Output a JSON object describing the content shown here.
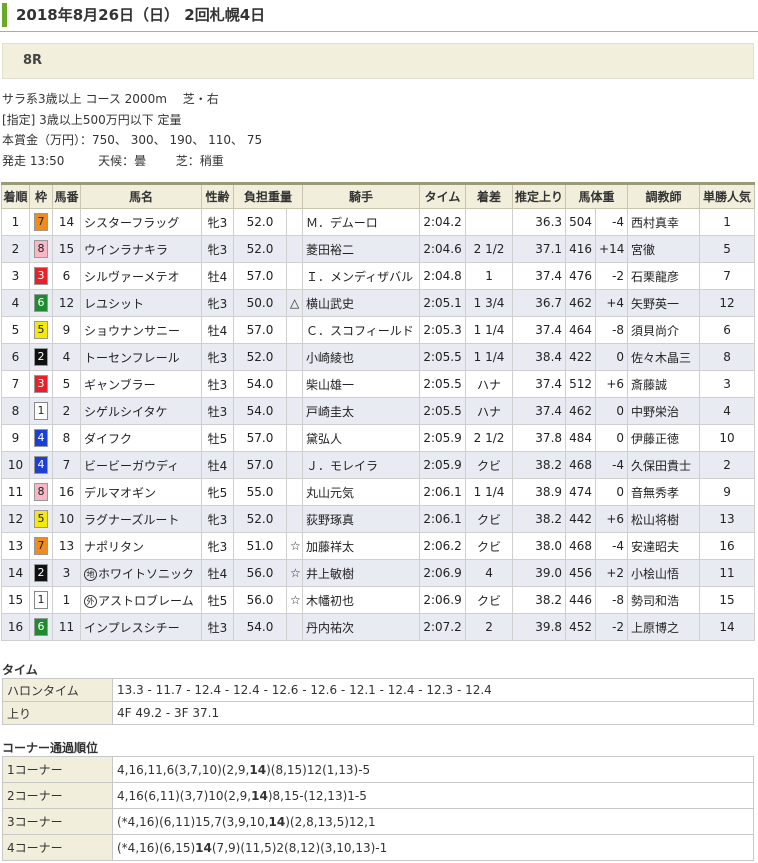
{
  "header": {
    "title": "2018年8月26日（日） 2回札幌4日",
    "race_number": "8R"
  },
  "race_info": {
    "line1": "サラ系3歳以上 コース 2000m　 芝・右",
    "line2": "[指定] 3歳以上500万円以下 定量",
    "line3": "本賞金（万円）：750、 300、 190、 110、 75",
    "line4_start": "発走 13:50",
    "line4_weather": "天候：曇",
    "line4_going": "芝：稍重"
  },
  "table": {
    "headers": [
      "着順",
      "枠",
      "馬番",
      "馬名",
      "性齢",
      "負担重量",
      "",
      "騎手",
      "タイム",
      "着差",
      "推定上り",
      "馬体重",
      "",
      "調教師",
      "単勝人気"
    ],
    "rows": [
      {
        "rank": "1",
        "waku": "7",
        "num": "14",
        "mark": "",
        "name": "シスターフラッグ",
        "sexage": "牝3",
        "weight": "52.0",
        "jmark": "",
        "jockey": "Ｍ．デムーロ",
        "time": "2:04.2",
        "margin": "",
        "agari": "36.3",
        "bw": "504",
        "bwdiff": "-4",
        "trainer": "西村真幸",
        "pop": "1"
      },
      {
        "rank": "2",
        "waku": "8",
        "num": "15",
        "mark": "",
        "name": "ウインラナキラ",
        "sexage": "牝3",
        "weight": "52.0",
        "jmark": "",
        "jockey": "菱田裕二",
        "time": "2:04.6",
        "margin": "2 1/2",
        "agari": "37.1",
        "bw": "416",
        "bwdiff": "+14",
        "trainer": "宮徹",
        "pop": "5"
      },
      {
        "rank": "3",
        "waku": "3",
        "num": "6",
        "mark": "",
        "name": "シルヴァーメテオ",
        "sexage": "牡4",
        "weight": "57.0",
        "jmark": "",
        "jockey": "Ｉ．メンディザバル",
        "time": "2:04.8",
        "margin": "1",
        "agari": "37.4",
        "bw": "476",
        "bwdiff": "-2",
        "trainer": "石栗龍彦",
        "pop": "7"
      },
      {
        "rank": "4",
        "waku": "6",
        "num": "12",
        "mark": "",
        "name": "レユシット",
        "sexage": "牝3",
        "weight": "50.0",
        "jmark": "△",
        "jockey": "横山武史",
        "time": "2:05.1",
        "margin": "1 3/4",
        "agari": "36.7",
        "bw": "462",
        "bwdiff": "+4",
        "trainer": "矢野英一",
        "pop": "12"
      },
      {
        "rank": "5",
        "waku": "5",
        "num": "9",
        "mark": "",
        "name": "ショウナンサニー",
        "sexage": "牡4",
        "weight": "57.0",
        "jmark": "",
        "jockey": "Ｃ．スコフィールド",
        "time": "2:05.3",
        "margin": "1 1/4",
        "agari": "37.4",
        "bw": "464",
        "bwdiff": "-8",
        "trainer": "須貝尚介",
        "pop": "6"
      },
      {
        "rank": "6",
        "waku": "2",
        "num": "4",
        "mark": "",
        "name": "トーセンフレール",
        "sexage": "牝3",
        "weight": "52.0",
        "jmark": "",
        "jockey": "小崎綾也",
        "time": "2:05.5",
        "margin": "1 1/4",
        "agari": "38.4",
        "bw": "422",
        "bwdiff": "0",
        "trainer": "佐々木晶三",
        "pop": "8"
      },
      {
        "rank": "7",
        "waku": "3",
        "num": "5",
        "mark": "",
        "name": "ギャンブラー",
        "sexage": "牡3",
        "weight": "54.0",
        "jmark": "",
        "jockey": "柴山雄一",
        "time": "2:05.5",
        "margin": "ハナ",
        "agari": "37.4",
        "bw": "512",
        "bwdiff": "+6",
        "trainer": "斎藤誠",
        "pop": "3"
      },
      {
        "rank": "8",
        "waku": "1",
        "num": "2",
        "mark": "",
        "name": "シゲルシイタケ",
        "sexage": "牡3",
        "weight": "54.0",
        "jmark": "",
        "jockey": "戸崎圭太",
        "time": "2:05.5",
        "margin": "ハナ",
        "agari": "37.4",
        "bw": "462",
        "bwdiff": "0",
        "trainer": "中野栄治",
        "pop": "4"
      },
      {
        "rank": "9",
        "waku": "4",
        "num": "8",
        "mark": "",
        "name": "ダイフク",
        "sexage": "牡5",
        "weight": "57.0",
        "jmark": "",
        "jockey": "黛弘人",
        "time": "2:05.9",
        "margin": "2 1/2",
        "agari": "37.8",
        "bw": "484",
        "bwdiff": "0",
        "trainer": "伊藤正徳",
        "pop": "10"
      },
      {
        "rank": "10",
        "waku": "4",
        "num": "7",
        "mark": "",
        "name": "ビービーガウディ",
        "sexage": "牡4",
        "weight": "57.0",
        "jmark": "",
        "jockey": "Ｊ．モレイラ",
        "time": "2:05.9",
        "margin": "クビ",
        "agari": "38.2",
        "bw": "468",
        "bwdiff": "-4",
        "trainer": "久保田貴士",
        "pop": "2"
      },
      {
        "rank": "11",
        "waku": "8",
        "num": "16",
        "mark": "",
        "name": "デルマオギン",
        "sexage": "牝5",
        "weight": "55.0",
        "jmark": "",
        "jockey": "丸山元気",
        "time": "2:06.1",
        "margin": "1 1/4",
        "agari": "38.9",
        "bw": "474",
        "bwdiff": "0",
        "trainer": "音無秀孝",
        "pop": "9"
      },
      {
        "rank": "12",
        "waku": "5",
        "num": "10",
        "mark": "",
        "name": "ラグナーズルート",
        "sexage": "牝3",
        "weight": "52.0",
        "jmark": "",
        "jockey": "荻野琢真",
        "time": "2:06.1",
        "margin": "クビ",
        "agari": "38.2",
        "bw": "442",
        "bwdiff": "+6",
        "trainer": "松山将樹",
        "pop": "13"
      },
      {
        "rank": "13",
        "waku": "7",
        "num": "13",
        "mark": "",
        "name": "ナポリタン",
        "sexage": "牝3",
        "weight": "51.0",
        "jmark": "☆",
        "jockey": "加藤祥太",
        "time": "2:06.2",
        "margin": "クビ",
        "agari": "38.0",
        "bw": "468",
        "bwdiff": "-4",
        "trainer": "安達昭夫",
        "pop": "16"
      },
      {
        "rank": "14",
        "waku": "2",
        "num": "3",
        "mark": "地",
        "name": "ホワイトソニック",
        "sexage": "牡4",
        "weight": "56.0",
        "jmark": "☆",
        "jockey": "井上敏樹",
        "time": "2:06.9",
        "margin": "4",
        "agari": "39.0",
        "bw": "456",
        "bwdiff": "+2",
        "trainer": "小桧山悟",
        "pop": "11"
      },
      {
        "rank": "15",
        "waku": "1",
        "num": "1",
        "mark": "外",
        "name": "アストロブレーム",
        "sexage": "牡5",
        "weight": "56.0",
        "jmark": "☆",
        "jockey": "木幡初也",
        "time": "2:06.9",
        "margin": "クビ",
        "agari": "38.2",
        "bw": "446",
        "bwdiff": "-8",
        "trainer": "勢司和浩",
        "pop": "15"
      },
      {
        "rank": "16",
        "waku": "6",
        "num": "11",
        "mark": "",
        "name": "インプレスシチー",
        "sexage": "牡3",
        "weight": "54.0",
        "jmark": "",
        "jockey": "丹内祐次",
        "time": "2:07.2",
        "margin": "2",
        "agari": "39.8",
        "bw": "452",
        "bwdiff": "-2",
        "trainer": "上原博之",
        "pop": "14"
      }
    ]
  },
  "waku_colors": {
    "1": {
      "bg": "#ffffff",
      "fg": "#222222"
    },
    "2": {
      "bg": "#111111",
      "fg": "#ffffff"
    },
    "3": {
      "bg": "#e8202a",
      "fg": "#ffffff"
    },
    "4": {
      "bg": "#1c3fd6",
      "fg": "#ffffff"
    },
    "5": {
      "bg": "#f5e80e",
      "fg": "#222222"
    },
    "6": {
      "bg": "#1e8c2e",
      "fg": "#ffffff"
    },
    "7": {
      "bg": "#f08c1e",
      "fg": "#222222"
    },
    "8": {
      "bg": "#f6b8c6",
      "fg": "#222222"
    }
  },
  "time_section": {
    "title": "タイム",
    "rows": [
      {
        "label": "ハロンタイム",
        "value": "13.3 - 11.7 - 12.4 - 12.4 - 12.6 - 12.6 - 12.1 - 12.4 - 12.3 - 12.4"
      },
      {
        "label": "上り",
        "value": "4F 49.2 - 3F 37.1"
      }
    ]
  },
  "corner_section": {
    "title": "コーナー通過順位",
    "rows": [
      {
        "label": "1コーナー",
        "parts": [
          "4,16,11,6(3,7,10)(2,9,",
          "14",
          ")(8,15)12(1,13)-5"
        ]
      },
      {
        "label": "2コーナー",
        "parts": [
          "4,16(6,11)(3,7)10(2,9,",
          "14",
          ")8,15-(12,13)1-5"
        ]
      },
      {
        "label": "3コーナー",
        "parts": [
          "(*4,16)(6,11)15,7(3,9,10,",
          "14",
          ")(2,8,13,5)12,1"
        ]
      },
      {
        "label": "4コーナー",
        "parts": [
          "(*4,16)(6,15)",
          "14",
          "(7,9)(11,5)2(8,12)(3,10,13)-1"
        ]
      }
    ]
  }
}
